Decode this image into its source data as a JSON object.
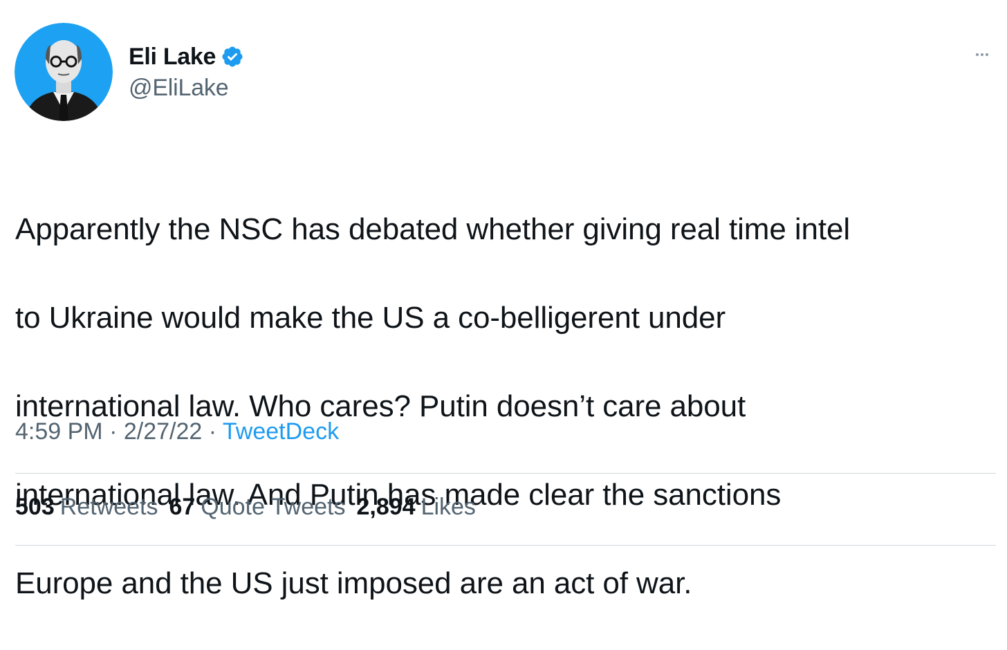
{
  "author": {
    "display_name": "Eli Lake",
    "handle": "@EliLake",
    "verified": true,
    "avatar_background": "#1da1f2"
  },
  "tweet": {
    "text_lines": [
      "Apparently the NSC has debated whether giving real time intel",
      "to Ukraine would make the US a co-belligerent under",
      "international law. Who cares? Putin doesn’t care about",
      "international law. And Putin has made clear the sanctions",
      "Europe and the US just imposed are an act of war."
    ]
  },
  "meta": {
    "time": "4:59 PM",
    "separator1": " · ",
    "date": "2/27/22",
    "separator2": " · ",
    "source": "TweetDeck"
  },
  "stats": {
    "retweets_count": "503",
    "retweets_label": "Retweets",
    "quotes_count": "67",
    "quotes_label": "Quote Tweets",
    "likes_count": "2,894",
    "likes_label": "Likes"
  },
  "icons": {
    "verified": "verified-badge-icon",
    "more": "more-options-icon"
  },
  "colors": {
    "accent": "#1d9bf0",
    "secondary_text": "#536471",
    "primary_text": "#0f1419",
    "divider": "#cfd9de"
  }
}
